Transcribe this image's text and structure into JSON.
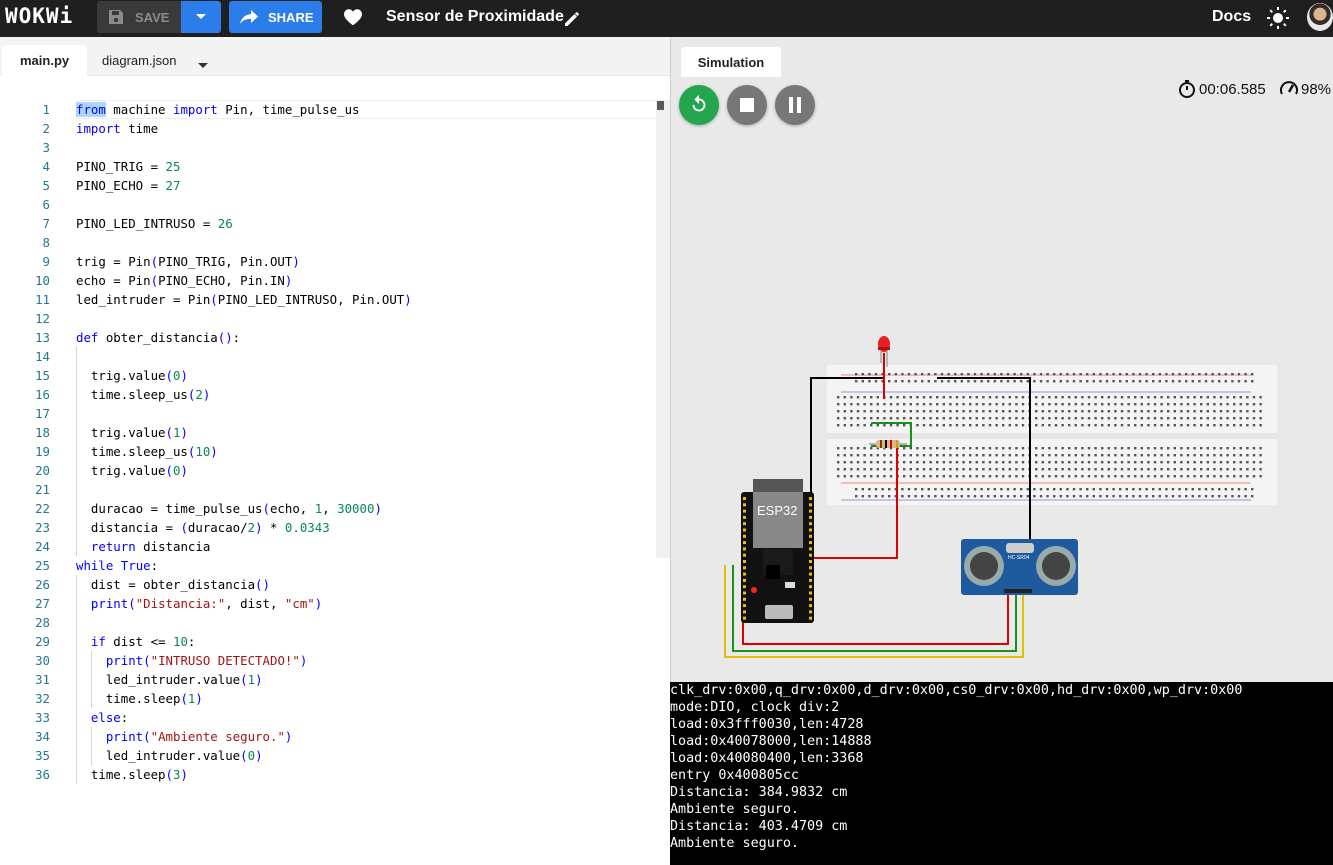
{
  "topbar": {
    "logo": "WOKWi",
    "save_label": "SAVE",
    "share_label": "SHARE",
    "project_title": "Sensor de Proximidade",
    "docs_label": "Docs"
  },
  "editor": {
    "tabs": [
      {
        "label": "main.py",
        "active": true
      },
      {
        "label": "diagram.json",
        "active": false
      }
    ],
    "lines": [
      {
        "n": "1",
        "indent": 0,
        "tokens": [
          [
            "kw",
            "from"
          ],
          [
            "t",
            " machine "
          ],
          [
            "kw",
            "import"
          ],
          [
            "t",
            " Pin, time_pulse_us"
          ]
        ]
      },
      {
        "n": "2",
        "indent": 0,
        "tokens": [
          [
            "kw",
            "import"
          ],
          [
            "t",
            " time"
          ]
        ]
      },
      {
        "n": "3",
        "indent": 0,
        "tokens": []
      },
      {
        "n": "4",
        "indent": 0,
        "tokens": [
          [
            "t",
            "PINO_TRIG = "
          ],
          [
            "num",
            "25"
          ]
        ]
      },
      {
        "n": "5",
        "indent": 0,
        "tokens": [
          [
            "t",
            "PINO_ECHO = "
          ],
          [
            "num",
            "27"
          ]
        ]
      },
      {
        "n": "6",
        "indent": 0,
        "tokens": []
      },
      {
        "n": "7",
        "indent": 0,
        "tokens": [
          [
            "t",
            "PINO_LED_INTRUSO = "
          ],
          [
            "num",
            "26"
          ]
        ]
      },
      {
        "n": "8",
        "indent": 0,
        "tokens": []
      },
      {
        "n": "9",
        "indent": 0,
        "tokens": [
          [
            "t",
            "trig = Pin"
          ],
          [
            "kw",
            "("
          ],
          [
            "t",
            "PINO_TRIG, Pin.OUT"
          ],
          [
            "kw",
            ")"
          ]
        ]
      },
      {
        "n": "10",
        "indent": 0,
        "tokens": [
          [
            "t",
            "echo = Pin"
          ],
          [
            "kw",
            "("
          ],
          [
            "t",
            "PINO_ECHO, Pin.IN"
          ],
          [
            "kw",
            ")"
          ]
        ]
      },
      {
        "n": "11",
        "indent": 0,
        "tokens": [
          [
            "t",
            "led_intruder = Pin"
          ],
          [
            "kw",
            "("
          ],
          [
            "t",
            "PINO_LED_INTRUSO, Pin.OUT"
          ],
          [
            "kw",
            ")"
          ]
        ]
      },
      {
        "n": "12",
        "indent": 0,
        "tokens": []
      },
      {
        "n": "13",
        "indent": 0,
        "tokens": [
          [
            "kw",
            "def"
          ],
          [
            "t",
            " obter_distancia"
          ],
          [
            "kw",
            "()"
          ],
          [
            "t",
            ":"
          ]
        ]
      },
      {
        "n": "14",
        "indent": 1,
        "tokens": []
      },
      {
        "n": "15",
        "indent": 1,
        "tokens": [
          [
            "t",
            "  trig.value"
          ],
          [
            "kw",
            "("
          ],
          [
            "num",
            "0"
          ],
          [
            "kw",
            ")"
          ]
        ]
      },
      {
        "n": "16",
        "indent": 1,
        "tokens": [
          [
            "t",
            "  time.sleep_us"
          ],
          [
            "kw",
            "("
          ],
          [
            "num",
            "2"
          ],
          [
            "kw",
            ")"
          ]
        ]
      },
      {
        "n": "17",
        "indent": 1,
        "tokens": []
      },
      {
        "n": "18",
        "indent": 1,
        "tokens": [
          [
            "t",
            "  trig.value"
          ],
          [
            "kw",
            "("
          ],
          [
            "num",
            "1"
          ],
          [
            "kw",
            ")"
          ]
        ]
      },
      {
        "n": "19",
        "indent": 1,
        "tokens": [
          [
            "t",
            "  time.sleep_us"
          ],
          [
            "kw",
            "("
          ],
          [
            "num",
            "10"
          ],
          [
            "kw",
            ")"
          ]
        ]
      },
      {
        "n": "20",
        "indent": 1,
        "tokens": [
          [
            "t",
            "  trig.value"
          ],
          [
            "kw",
            "("
          ],
          [
            "num",
            "0"
          ],
          [
            "kw",
            ")"
          ]
        ]
      },
      {
        "n": "21",
        "indent": 1,
        "tokens": []
      },
      {
        "n": "22",
        "indent": 1,
        "tokens": [
          [
            "t",
            "  duracao = time_pulse_us"
          ],
          [
            "kw",
            "("
          ],
          [
            "t",
            "echo, "
          ],
          [
            "num",
            "1"
          ],
          [
            "t",
            ", "
          ],
          [
            "num",
            "30000"
          ],
          [
            "kw",
            ")"
          ]
        ]
      },
      {
        "n": "23",
        "indent": 1,
        "tokens": [
          [
            "t",
            "  distancia = "
          ],
          [
            "kw",
            "("
          ],
          [
            "t",
            "duracao/"
          ],
          [
            "num",
            "2"
          ],
          [
            "kw",
            ")"
          ],
          [
            "t",
            " * "
          ],
          [
            "num",
            "0.0343"
          ]
        ]
      },
      {
        "n": "24",
        "indent": 1,
        "tokens": [
          [
            "t",
            "  "
          ],
          [
            "kw",
            "return"
          ],
          [
            "t",
            " distancia"
          ]
        ]
      },
      {
        "n": "25",
        "indent": 0,
        "tokens": [
          [
            "kw",
            "while"
          ],
          [
            "t",
            " "
          ],
          [
            "kw",
            "True"
          ],
          [
            "t",
            ":"
          ]
        ]
      },
      {
        "n": "26",
        "indent": 1,
        "tokens": [
          [
            "t",
            "  dist = obter_distancia"
          ],
          [
            "kw",
            "()"
          ]
        ]
      },
      {
        "n": "27",
        "indent": 1,
        "tokens": [
          [
            "t",
            "  "
          ],
          [
            "kw",
            "print"
          ],
          [
            "kw",
            "("
          ],
          [
            "str",
            "\"Distancia:\""
          ],
          [
            "t",
            ", dist, "
          ],
          [
            "str",
            "\"cm\""
          ],
          [
            "kw",
            ")"
          ]
        ]
      },
      {
        "n": "28",
        "indent": 1,
        "tokens": []
      },
      {
        "n": "29",
        "indent": 1,
        "tokens": [
          [
            "t",
            "  "
          ],
          [
            "kw",
            "if"
          ],
          [
            "t",
            " dist <= "
          ],
          [
            "num",
            "10"
          ],
          [
            "t",
            ":"
          ]
        ]
      },
      {
        "n": "30",
        "indent": 2,
        "tokens": [
          [
            "t",
            "    "
          ],
          [
            "kw",
            "print"
          ],
          [
            "kw",
            "("
          ],
          [
            "str",
            "\"INTRUSO DETECTADO!\""
          ],
          [
            "kw",
            ")"
          ]
        ]
      },
      {
        "n": "31",
        "indent": 2,
        "tokens": [
          [
            "t",
            "    led_intruder.value"
          ],
          [
            "kw",
            "("
          ],
          [
            "num",
            "1"
          ],
          [
            "kw",
            ")"
          ]
        ]
      },
      {
        "n": "32",
        "indent": 2,
        "tokens": [
          [
            "t",
            "    time.sleep"
          ],
          [
            "kw",
            "("
          ],
          [
            "num",
            "1"
          ],
          [
            "kw",
            ")"
          ]
        ]
      },
      {
        "n": "33",
        "indent": 1,
        "tokens": [
          [
            "t",
            "  "
          ],
          [
            "kw",
            "else"
          ],
          [
            "t",
            ":"
          ]
        ]
      },
      {
        "n": "34",
        "indent": 2,
        "tokens": [
          [
            "t",
            "    "
          ],
          [
            "kw",
            "print"
          ],
          [
            "kw",
            "("
          ],
          [
            "str",
            "\"Ambiente seguro.\""
          ],
          [
            "kw",
            ")"
          ]
        ]
      },
      {
        "n": "35",
        "indent": 2,
        "tokens": [
          [
            "t",
            "    led_intruder.value"
          ],
          [
            "kw",
            "("
          ],
          [
            "num",
            "0"
          ],
          [
            "kw",
            ")"
          ]
        ]
      },
      {
        "n": "36",
        "indent": 1,
        "tokens": [
          [
            "t",
            "  time.sleep"
          ],
          [
            "kw",
            "("
          ],
          [
            "num",
            "3"
          ],
          [
            "kw",
            ")"
          ]
        ]
      }
    ]
  },
  "simulation": {
    "tab_label": "Simulation",
    "timer": "00:06.585",
    "speed": "98%",
    "esp_label": "ESP32",
    "sensor_label": "HC-SR04"
  },
  "console": {
    "lines": [
      "clk_drv:0x00,q_drv:0x00,d_drv:0x00,cs0_drv:0x00,hd_drv:0x00,wp_drv:0x00",
      "mode:DIO, clock div:2",
      "load:0x3fff0030,len:4728",
      "load:0x40078000,len:14888",
      "load:0x40080400,len:3368",
      "entry 0x400805cc",
      "Distancia: 384.9832 cm",
      "Ambiente seguro.",
      "Distancia: 403.4709 cm",
      "Ambiente seguro."
    ]
  },
  "colors": {
    "topbar_bg": "#1f1f1f",
    "accent_blue": "#2b7de9",
    "run_green": "#23a64d",
    "keyword": "#0000ff",
    "number": "#098658",
    "string": "#a31515",
    "line_number": "#237893"
  },
  "icons": [
    "save-icon",
    "chevron-down-icon",
    "share-icon",
    "heart-icon",
    "pencil-icon",
    "sun-icon",
    "avatar",
    "restart-icon",
    "stop-icon",
    "pause-icon",
    "stopwatch-icon",
    "speedometer-icon"
  ]
}
